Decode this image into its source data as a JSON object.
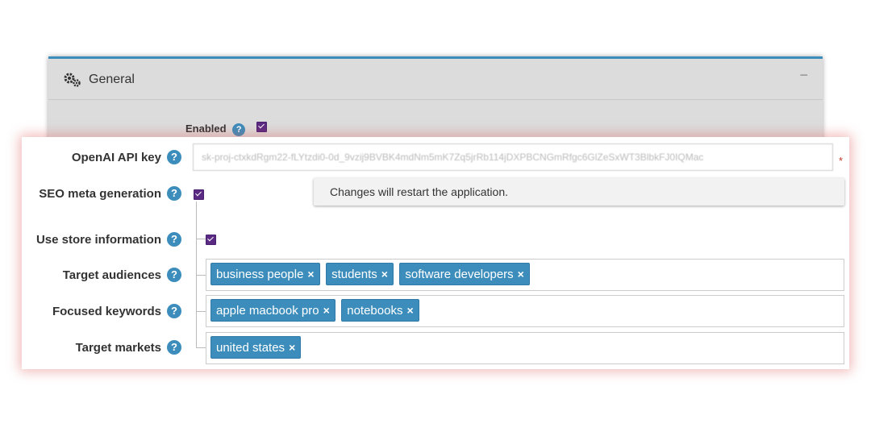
{
  "panel": {
    "title": "General",
    "collapse_glyph": "−",
    "enabled_label": "Enabled"
  },
  "form": {
    "api_key": {
      "label": "OpenAI API key",
      "value": "sk-proj-ctxkdRgm22-fLYtzdi0-0d_9vzij9BVBK4mdNm5mK7Zq5jrRb114jDXPBCNGmRfgc6GlZeSxWT3BlbkFJ0IQMac",
      "required_mark": "*"
    },
    "seo_meta": {
      "label": "SEO meta generation",
      "checked": true
    },
    "notice": "Changes will restart the application.",
    "use_store": {
      "label": "Use store information",
      "checked": true
    },
    "target_audiences": {
      "label": "Target audiences",
      "tags": [
        "business people",
        "students",
        "software developers"
      ]
    },
    "focused_keywords": {
      "label": "Focused keywords",
      "tags": [
        "apple macbook pro",
        "notebooks"
      ]
    },
    "target_markets": {
      "label": "Target markets",
      "tags": [
        "united states"
      ]
    },
    "help_glyph": "?",
    "remove_glyph": "×"
  },
  "colors": {
    "accent": "#3c8dbc",
    "checkbox": "#5b2a83",
    "required": "#c0392b"
  }
}
